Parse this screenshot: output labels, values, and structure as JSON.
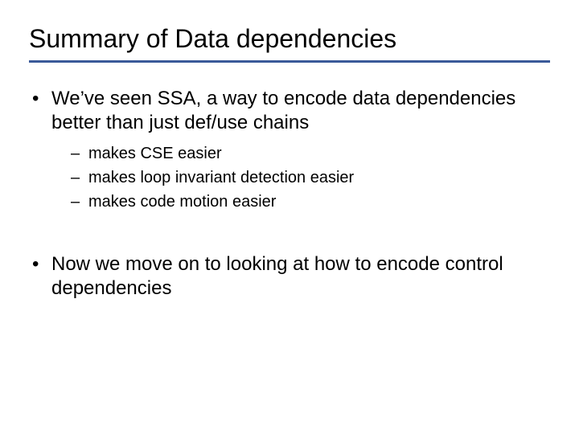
{
  "title": "Summary of Data dependencies",
  "bullets": {
    "b1": "We’ve seen SSA, a way to encode data dependencies better than just def/use chains",
    "b1_sub": {
      "s1": "makes CSE easier",
      "s2": "makes loop invariant detection easier",
      "s3": "makes code motion easier"
    },
    "b2": "Now we move on to looking at how to encode control dependencies"
  }
}
